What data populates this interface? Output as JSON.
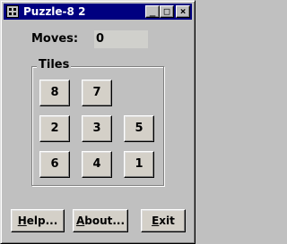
{
  "window": {
    "title": "Puzzle-8 2",
    "minimize_glyph": "_",
    "maximize_glyph": "□",
    "close_glyph": "×"
  },
  "moves": {
    "label": "Moves:",
    "value": "0"
  },
  "tiles": {
    "label": "Tiles",
    "grid": [
      [
        "8",
        "7",
        ""
      ],
      [
        "2",
        "3",
        "5"
      ],
      [
        "6",
        "4",
        "1"
      ]
    ]
  },
  "buttons": {
    "help": {
      "first": "H",
      "rest": "elp..."
    },
    "about": {
      "first": "A",
      "rest": "bout..."
    },
    "exit": {
      "first": "E",
      "rest": "xit"
    }
  }
}
